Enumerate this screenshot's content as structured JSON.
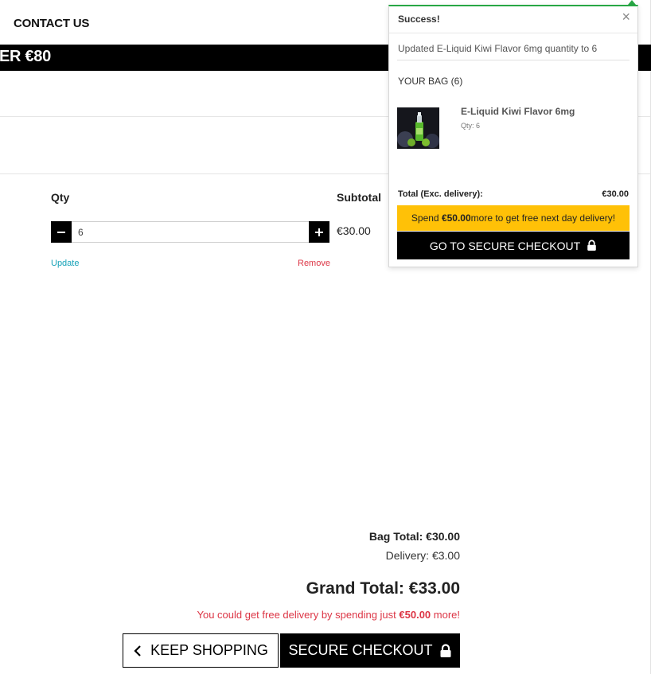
{
  "header": {
    "contact_label": "CONTACT US",
    "promo_text": "ER €80"
  },
  "cart": {
    "qty_header": "Qty",
    "subtotal_header": "Subtotal",
    "item": {
      "quantity": "6",
      "subtotal": "€30.00",
      "minus_label": "−",
      "plus_label": "+",
      "update_label": "Update",
      "remove_label": "Remove"
    }
  },
  "summary": {
    "bag_total": "Bag Total: €30.00",
    "delivery": "Delivery: €3.00",
    "grand_total": "Grand Total: €33.00",
    "free_delivery_prefix": "You could get free delivery by spending just ",
    "free_delivery_amount": "€50.00",
    "free_delivery_suffix": " more!",
    "keep_shopping_label": "KEEP SHOPPING",
    "secure_checkout_label": "SECURE CHECKOUT"
  },
  "toast": {
    "title": "Success!",
    "close_glyph": "×",
    "message": "Updated E-Liquid Kiwi Flavor 6mg quantity to 6",
    "bag_heading": "YOUR BAG (6)",
    "item_name": "E-Liquid Kiwi Flavor 6mg",
    "item_qty": "Qty: 6",
    "total_label": "Total (Exc. delivery):",
    "total_value": "€30.00",
    "spend_prefix": "Spend ",
    "spend_amount": "€50.00",
    "spend_suffix": " more to get free next day delivery!",
    "checkout_label": "GO TO SECURE CHECKOUT"
  },
  "colors": {
    "success_accent": "#28a745",
    "info_link": "#17a2b8",
    "danger": "#dc3545",
    "warning_bg": "#ffc107",
    "primary_dark": "#000000"
  },
  "icons": {
    "chevron": "chevron-left-icon",
    "lock": "lock-icon",
    "close": "close-icon"
  }
}
